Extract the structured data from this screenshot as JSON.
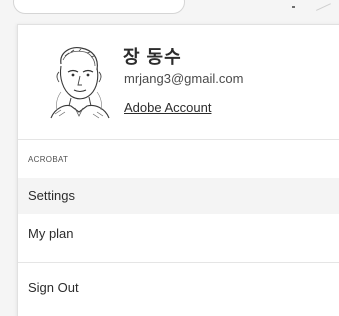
{
  "profile": {
    "name": "장 동수",
    "email": "mrjang3@gmail.com",
    "account_link": "Adobe Account"
  },
  "menu": {
    "section_label": "ACROBAT",
    "settings": "Settings",
    "my_plan": "My plan",
    "sign_out": "Sign Out"
  },
  "colors": {
    "hover_bg": "#f4f4f4",
    "divider": "#e5e5e5",
    "text": "#2c2c2c"
  }
}
